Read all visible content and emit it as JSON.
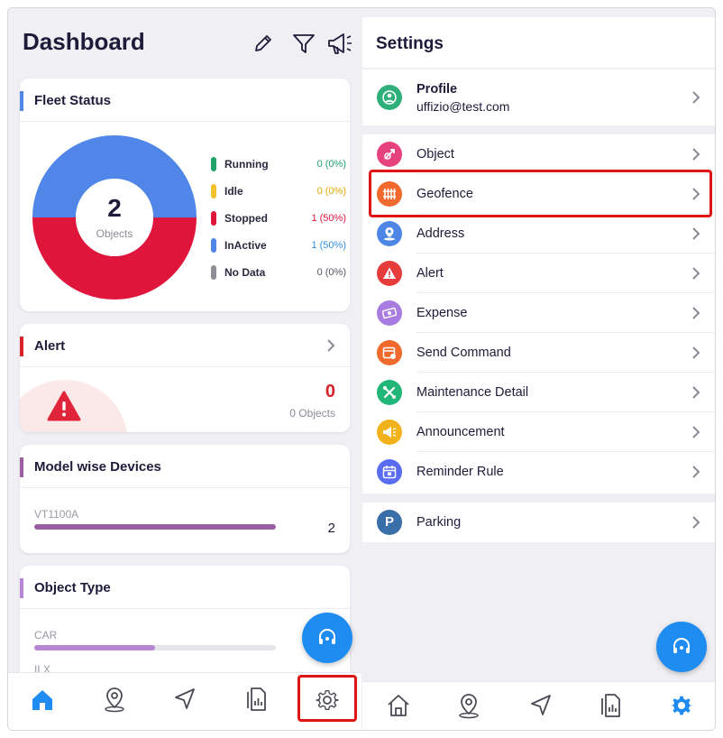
{
  "dashboard": {
    "title": "Dashboard",
    "header_icons": [
      "pencil-icon",
      "filter-icon",
      "megaphone-icon"
    ]
  },
  "fleet_status": {
    "title": "Fleet Status",
    "total": "2",
    "total_label": "Objects",
    "legend": [
      {
        "label": "Running",
        "value": "0 (0%)",
        "color": "#21a36a"
      },
      {
        "label": "Idle",
        "value": "0 (0%)",
        "color": "#f2c12e"
      },
      {
        "label": "Stopped",
        "value": "1 (50%)",
        "color": "#e0153c"
      },
      {
        "label": "InActive",
        "value": "1 (50%)",
        "color": "#4f86e8"
      },
      {
        "label": "No Data",
        "value": "0 (0%)",
        "color": "#8e8e96"
      }
    ]
  },
  "alert_card": {
    "title": "Alert",
    "count": "0",
    "objects": "0 Objects",
    "accent": "#d8222a"
  },
  "model_devices": {
    "title": "Model wise Devices",
    "model": "VT1100A",
    "count": "2",
    "fill": 1.0,
    "accent": "#9b5ea0"
  },
  "object_type": {
    "title": "Object Type",
    "rows": [
      {
        "label": "CAR",
        "fill": 0.5
      },
      {
        "label": "ILX",
        "fill": 0.0
      }
    ],
    "accent": "#b786d6"
  },
  "bottom_nav_left": [
    "home-icon",
    "map-pin-icon",
    "navigation-icon",
    "report-icon",
    "settings-icon"
  ],
  "settings": {
    "title": "Settings",
    "profile": {
      "label": "Profile",
      "email": "uffizio@test.com",
      "color": "#2fb07a"
    },
    "items": [
      {
        "label": "Object",
        "color": "#e5427e",
        "icon": "object-icon"
      },
      {
        "label": "Geofence",
        "color": "#f06a2d",
        "icon": "geofence-icon"
      },
      {
        "label": "Address",
        "color": "#4e86e6",
        "icon": "address-pin-icon"
      },
      {
        "label": "Alert",
        "color": "#e63c3c",
        "icon": "alert-icon"
      },
      {
        "label": "Expense",
        "color": "#a87ce0",
        "icon": "expense-icon"
      },
      {
        "label": "Send Command",
        "color": "#f06a2d",
        "icon": "command-icon"
      },
      {
        "label": "Maintenance Detail",
        "color": "#22b578",
        "icon": "tools-icon"
      },
      {
        "label": "Announcement",
        "color": "#f2b21c",
        "icon": "announcement-icon"
      },
      {
        "label": "Reminder Rule",
        "color": "#5a6cf0",
        "icon": "calendar-icon"
      }
    ],
    "parking": {
      "label": "Parking",
      "letter": "P",
      "color": "#3a6ea8"
    }
  },
  "bottom_nav_right": [
    "home-icon",
    "map-pin-icon",
    "navigation-icon",
    "report-icon",
    "settings-icon"
  ],
  "colors": {
    "accent_blue": "#1f8cf1",
    "highlight": "#e01414"
  }
}
